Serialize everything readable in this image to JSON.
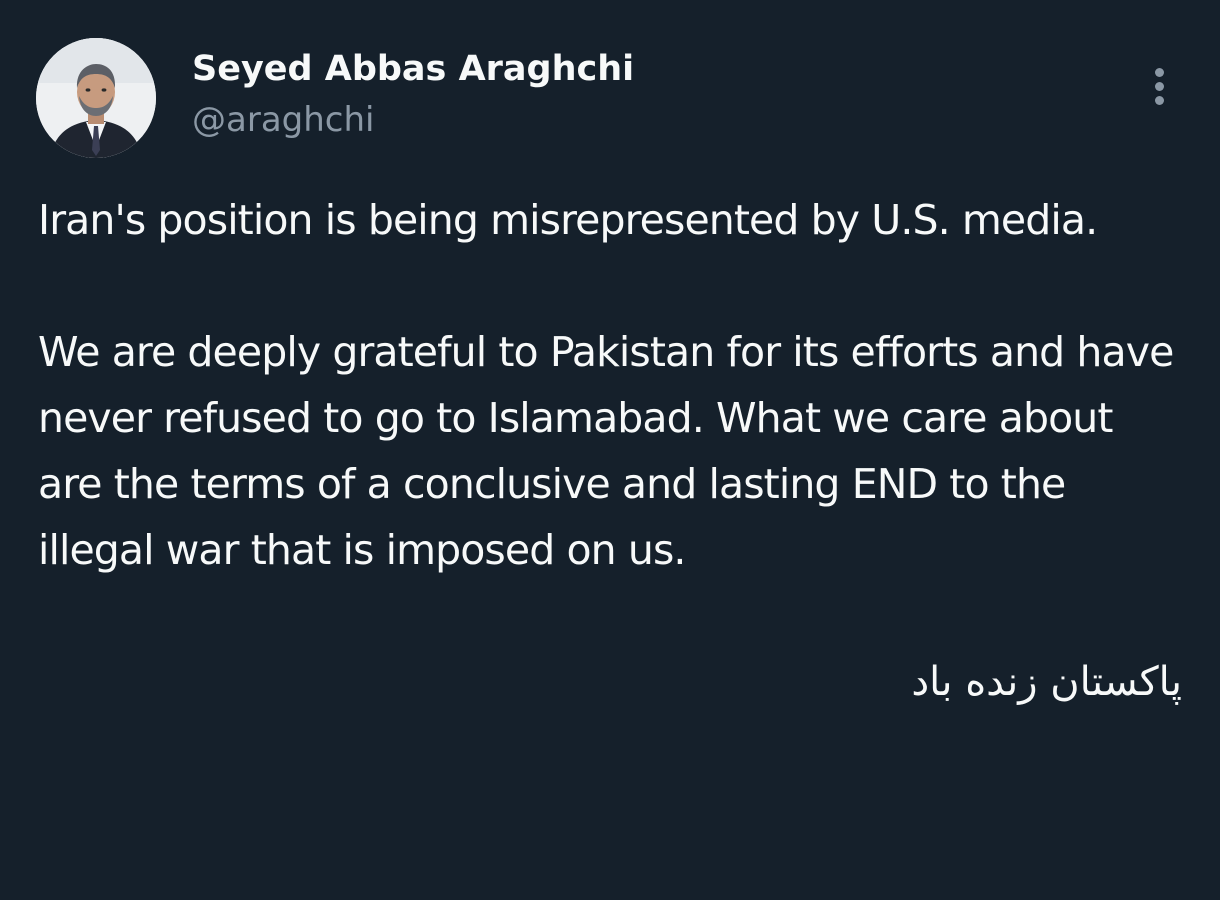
{
  "tweet": {
    "author": {
      "display_name": "Seyed Abbas Araghchi",
      "handle": "@araghchi",
      "avatar_icon": "profile-photo"
    },
    "more_menu_icon": "more-vertical-icon",
    "body": {
      "paragraph_1": "Iran's position is being misrepresented by U.S. media.",
      "paragraph_2": "We are deeply grateful to Pakistan for its efforts and have never refused to go to Islamabad. What we care about are the terms of a conclusive and lasting END to the illegal war that is imposed on us.",
      "paragraph_3": "پاکستان زنده باد"
    }
  },
  "colors": {
    "background": "#15202b",
    "primary_text": "#f7f9f9",
    "secondary_text": "#8b98a5"
  }
}
